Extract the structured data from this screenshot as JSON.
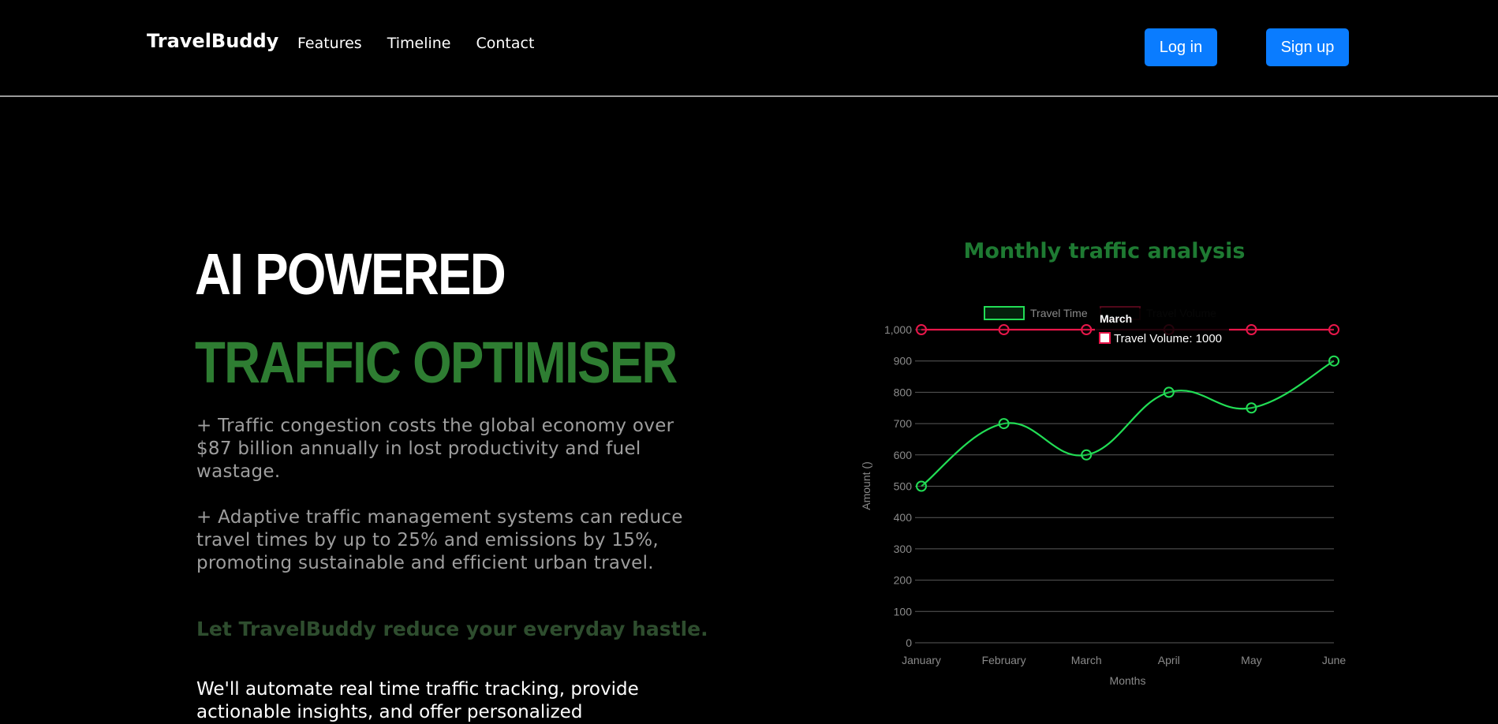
{
  "nav": {
    "brand": "TravelBuddy",
    "links": [
      "Features",
      "Timeline",
      "Contact"
    ],
    "login_label": "Log in",
    "signup_label": "Sign up"
  },
  "hero": {
    "line1": "AI POWERED",
    "line2": "TRAFFIC OPTIMISER",
    "para1": "+ Traffic congestion costs the global economy over $87 billion annually in lost productivity and fuel wastage.",
    "para2": "+ Adaptive traffic management systems can reduce travel times by up to 25% and emissions by 15%, promoting sustainable and efficient urban travel.",
    "tagline": "Let TravelBuddy reduce your everyday hastle.",
    "body": "We'll automate real time traffic tracking, provide actionable insights, and offer personalized"
  },
  "colors": {
    "background": "#000000",
    "accent_green": "#2e7d32",
    "chart_title_green": "#1e7a32",
    "button_blue": "#0a7cff",
    "series_green": "#22dd55",
    "series_red": "#e8174a"
  },
  "chart_data": {
    "type": "line",
    "title": "Monthly traffic analysis",
    "categories": [
      "January",
      "February",
      "March",
      "April",
      "May",
      "June"
    ],
    "xlabel": "Months",
    "ylabel": "Amount ()",
    "ylim": [
      0,
      1000
    ],
    "yticks": [
      "0",
      "100",
      "200",
      "300",
      "400",
      "500",
      "600",
      "700",
      "800",
      "900",
      "1,000"
    ],
    "series": [
      {
        "name": "Travel Time",
        "values": [
          500,
          700,
          600,
          800,
          750,
          900
        ],
        "color": "#22dd55"
      },
      {
        "name": "Travel Volume",
        "values": [
          1000,
          1000,
          1000,
          1000,
          1000,
          1000
        ],
        "color": "#e8174a"
      }
    ],
    "legend_placement": "top",
    "grid": true,
    "tooltip": {
      "title": "March",
      "body": "Travel Volume: 1000"
    }
  }
}
